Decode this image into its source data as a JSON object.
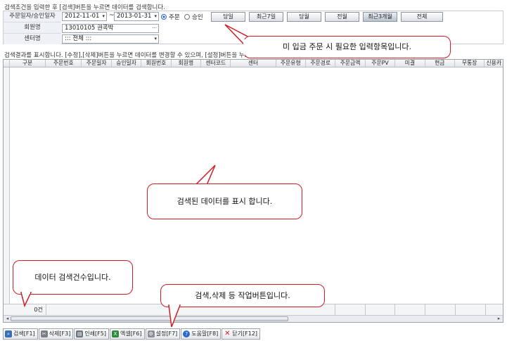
{
  "search": {
    "hint": "검색조건을 입력한 후 [검색]버튼을 누르면 데이터를 검색합니다.",
    "labels": {
      "date": "주문일자/승인일자",
      "member": "회원명",
      "center": "센터명"
    },
    "date_from": "2012-11-01",
    "date_sep": "~",
    "date_to": "2013-01-31",
    "radio_order": "주문",
    "radio_approve": "승인",
    "member_value": "13010105 권곡박",
    "member_btn": "···",
    "center_value": "::: 전체 :::",
    "period_buttons": [
      "당일",
      "최근7일",
      "당월",
      "전월",
      "최근3개월",
      "전체"
    ]
  },
  "results": {
    "hint": "검색결과를 표시합니다. [수정],[삭제]버튼을 누르면 데이터를 변경할 수 있으며, [설정]버튼을 누르면",
    "columns": [
      "구분",
      "주문번호",
      "주문일자",
      "승인일자",
      "회원번호",
      "회원명",
      "센터코드",
      "센터",
      "주문유형",
      "주문경로",
      "주문금액",
      "주문PV",
      "미결",
      "현금",
      "무통장",
      "신용카"
    ],
    "count": "0건"
  },
  "toolbar": {
    "search": "검색[F1]",
    "delete": "삭제[F3]",
    "print": "인쇄[F5]",
    "excel": "엑셀[F6]",
    "settings": "설정[F7]",
    "help": "도움말[F8]",
    "close": "닫기[F12]"
  },
  "callouts": {
    "input": "미 입금 주문 시 필요한 입력항목입니다.",
    "data": "검색된 데이터를 표시 합니다.",
    "count": "데이터 검색건수입니다.",
    "buttons": "검색,삭제 등 작업버튼입니다."
  },
  "colors": {
    "callout_border": "#d21d25",
    "label_bg": "#eef1f5"
  }
}
